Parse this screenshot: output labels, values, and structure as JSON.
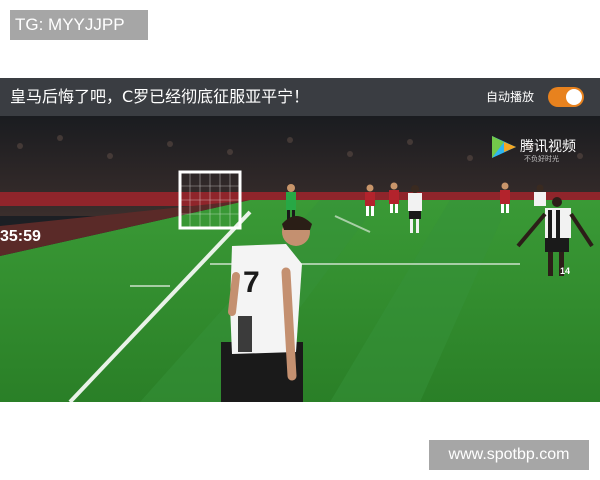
{
  "top_tag": {
    "text": "TG: MYYJJPP"
  },
  "player": {
    "title": "皇马后悔了吧，C罗已经彻底征服亚平宁！",
    "autoplay_label": "自动播放",
    "autoplay_on": true,
    "watermark": {
      "text": "腾讯视频",
      "subtitle": "不负好时光"
    },
    "scoreboard_clock": "35:59",
    "jersey_numbers": {
      "main_player": "7",
      "teammate": "14"
    }
  },
  "bottom_tag": {
    "text": "www.spotbp.com"
  },
  "colors": {
    "tag_bg": "#a6a6a6",
    "titlebar_bg": "#3a3d42",
    "toggle_on": "#e8821e",
    "pitch": "#2e8a2c"
  }
}
